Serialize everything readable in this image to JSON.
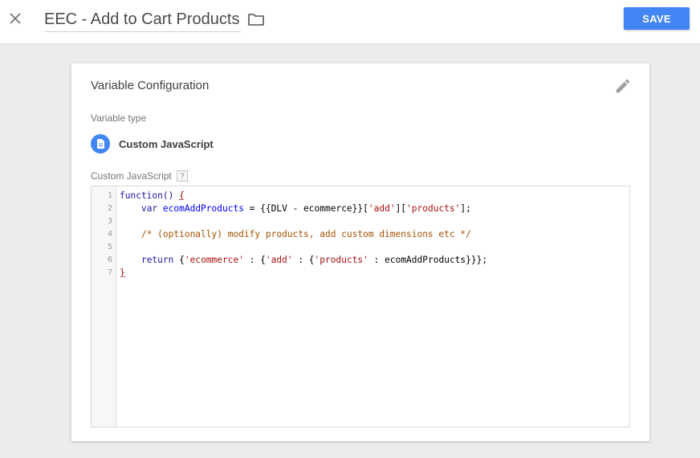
{
  "header": {
    "title": "EEC - Add to Cart Products",
    "save_label": "SAVE"
  },
  "card": {
    "title": "Variable Configuration",
    "variable_type_label": "Variable type",
    "variable_type_name": "Custom JavaScript",
    "code_label": "Custom JavaScript",
    "help_label": "?"
  },
  "editor": {
    "line_numbers": [
      "1",
      "2",
      "3",
      "4",
      "5",
      "6",
      "7"
    ],
    "lines": [
      {
        "tokens": [
          {
            "t": "kw",
            "v": "function() "
          },
          {
            "t": "brace",
            "v": "{"
          }
        ]
      },
      {
        "tokens": [
          {
            "t": "plain",
            "v": "    "
          },
          {
            "t": "kw",
            "v": "var "
          },
          {
            "t": "var",
            "v": "ecomAddProducts"
          },
          {
            "t": "plain",
            "v": " = {{DLV - ecommerce}}["
          },
          {
            "t": "str",
            "v": "'add'"
          },
          {
            "t": "plain",
            "v": "]["
          },
          {
            "t": "str",
            "v": "'products'"
          },
          {
            "t": "plain",
            "v": "];"
          }
        ]
      },
      {
        "tokens": []
      },
      {
        "tokens": [
          {
            "t": "plain",
            "v": "    "
          },
          {
            "t": "com",
            "v": "/* (optionally) modify products, add custom dimensions etc */"
          }
        ]
      },
      {
        "tokens": []
      },
      {
        "tokens": [
          {
            "t": "plain",
            "v": "    "
          },
          {
            "t": "kw",
            "v": "return "
          },
          {
            "t": "plain",
            "v": "{"
          },
          {
            "t": "str",
            "v": "'ecommerce'"
          },
          {
            "t": "plain",
            "v": " : {"
          },
          {
            "t": "str",
            "v": "'add'"
          },
          {
            "t": "plain",
            "v": " : {"
          },
          {
            "t": "str",
            "v": "'products'"
          },
          {
            "t": "plain",
            "v": " : ecomAddProducts}}};"
          }
        ]
      },
      {
        "tokens": [
          {
            "t": "brace",
            "v": "}"
          }
        ]
      }
    ]
  },
  "icons": {
    "close": "close-icon",
    "folder": "folder-icon",
    "edit": "pencil-icon",
    "type": "document-icon"
  },
  "colors": {
    "accent": "#4285f4",
    "background": "#ececec"
  }
}
